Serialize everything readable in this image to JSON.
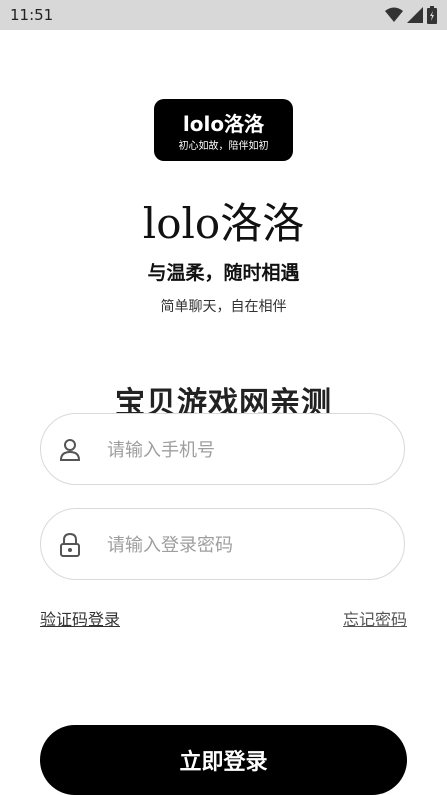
{
  "status_bar": {
    "time": "11:51"
  },
  "logo": {
    "title": "lolo洛洛",
    "subtitle": "初心如故，陪伴如初"
  },
  "app_name": "lolo洛洛",
  "tagline": "与温柔，随时相遇",
  "sub_tagline": "简单聊天，自在相伴",
  "watermark": "宝贝游戏网亲测",
  "form": {
    "phone_placeholder": "请输入手机号",
    "password_placeholder": "请输入登录密码",
    "sms_login_link": "验证码登录",
    "forgot_password_link": "忘记密码",
    "login_button": "立即登录"
  },
  "colors": {
    "primary": "#000000",
    "status_bar": "#d8d8d8",
    "border": "#d9d9d9",
    "placeholder": "#9e9e9e"
  }
}
